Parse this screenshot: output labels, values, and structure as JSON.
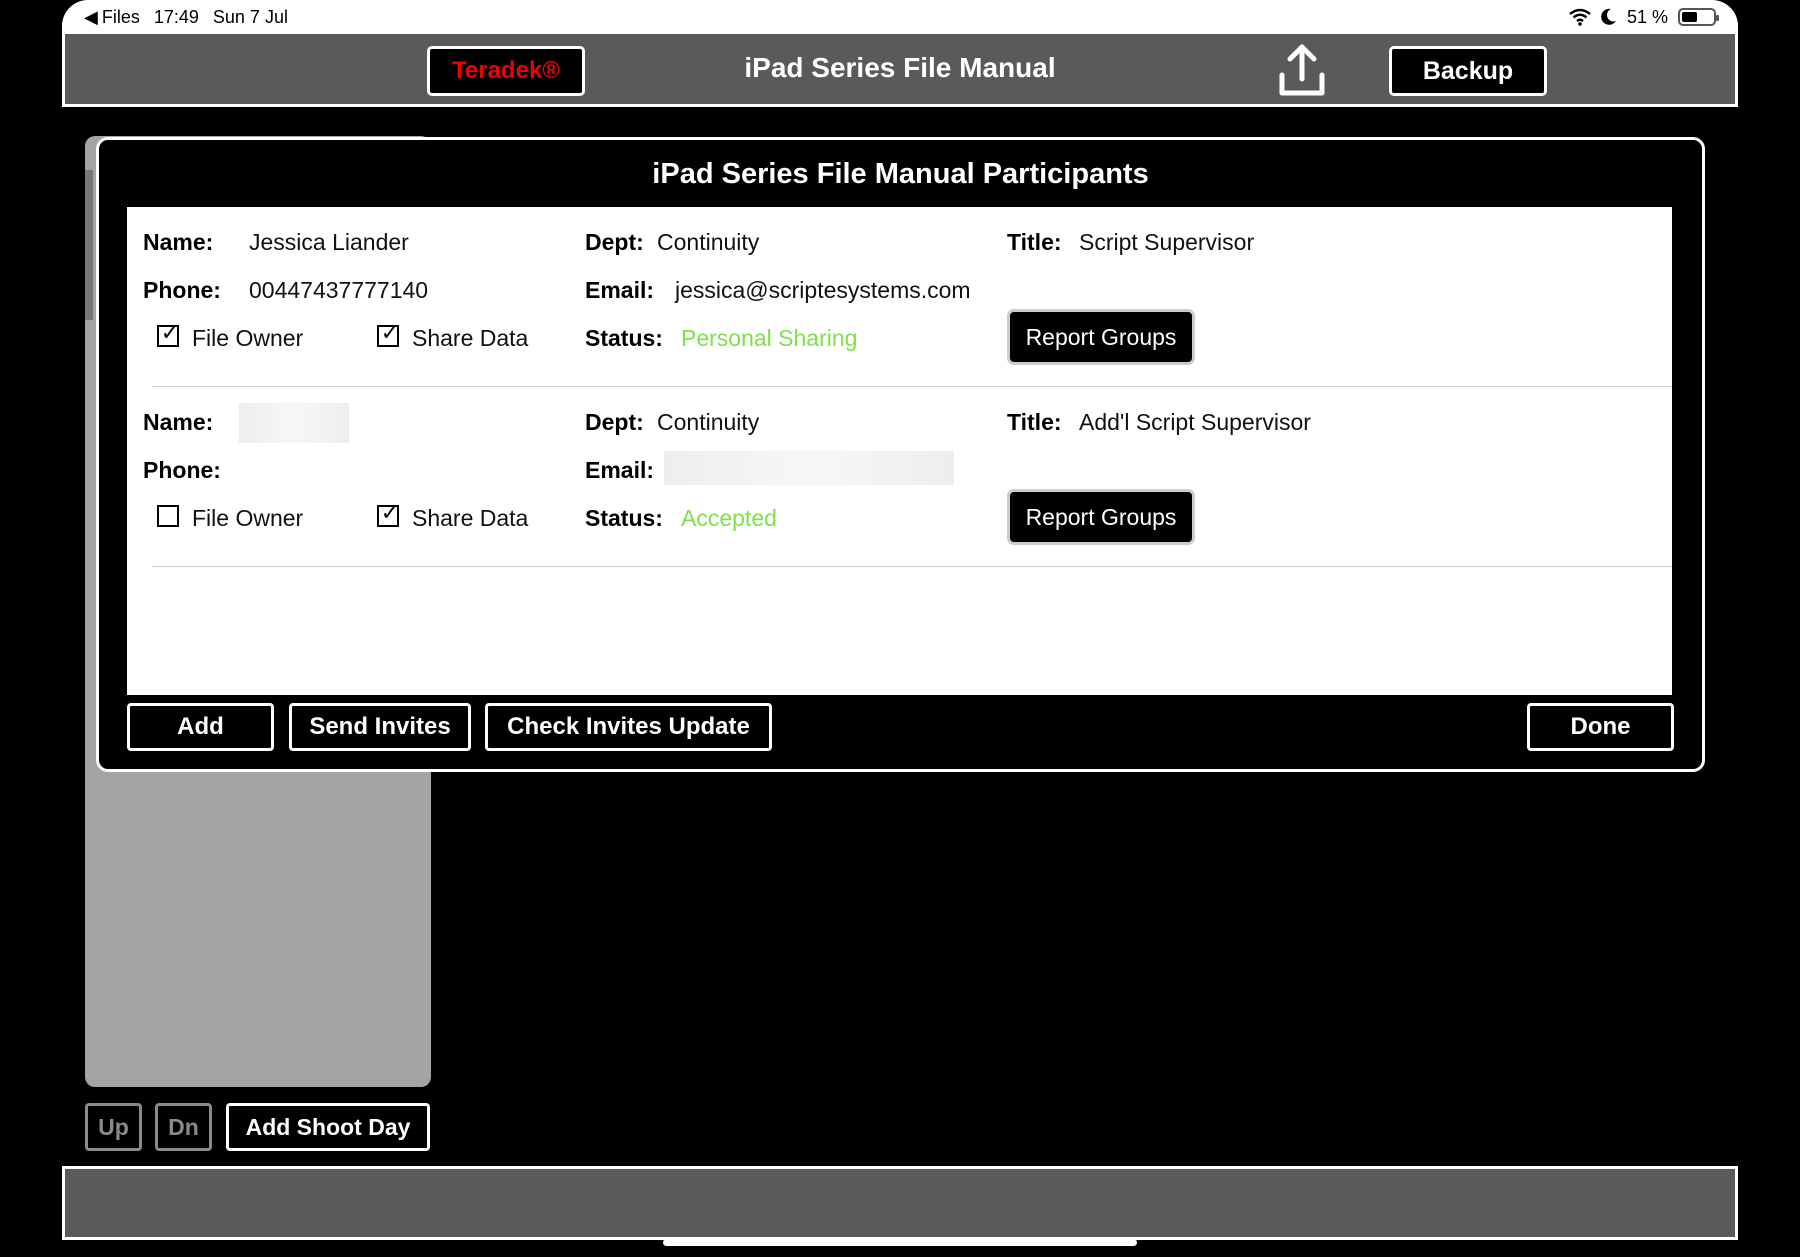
{
  "status_bar": {
    "back_app": "Files",
    "time": "17:49",
    "date": "Sun 7 Jul",
    "battery": "51 %",
    "battery_level": 0.51
  },
  "toolbar": {
    "brand_button": "Teradek®",
    "title": "iPad Series File Manual",
    "upload_icon": "upload-icon",
    "backup_button": "Backup"
  },
  "sidebar_controls": {
    "up": "Up",
    "down": "Dn",
    "add_shoot_day": "Add Shoot Day"
  },
  "modal": {
    "title": "iPad Series File Manual Participants",
    "labels": {
      "name": "Name:",
      "phone": "Phone:",
      "dept": "Dept:",
      "email": "Email:",
      "status": "Status:",
      "title": "Title:",
      "file_owner": "File Owner",
      "share_data": "Share Data",
      "report_groups": "Report Groups"
    },
    "participants": [
      {
        "name": "Jessica Liander",
        "phone": "00447437777140",
        "dept": "Continuity",
        "email": "jessica@scriptesystems.com",
        "title": "Script Supervisor",
        "status": "Personal Sharing",
        "file_owner": true,
        "share_data": true
      },
      {
        "name": "",
        "phone": "",
        "dept": "Continuity",
        "email": "",
        "title": "Add'l Script Supervisor",
        "status": "Accepted",
        "file_owner": false,
        "share_data": true
      }
    ],
    "buttons": {
      "add": "Add",
      "send_invites": "Send Invites",
      "check_invites_update": "Check Invites Update",
      "done": "Done"
    },
    "colors": {
      "status_green": "#7fe04a",
      "brand_red": "#e00000"
    }
  }
}
